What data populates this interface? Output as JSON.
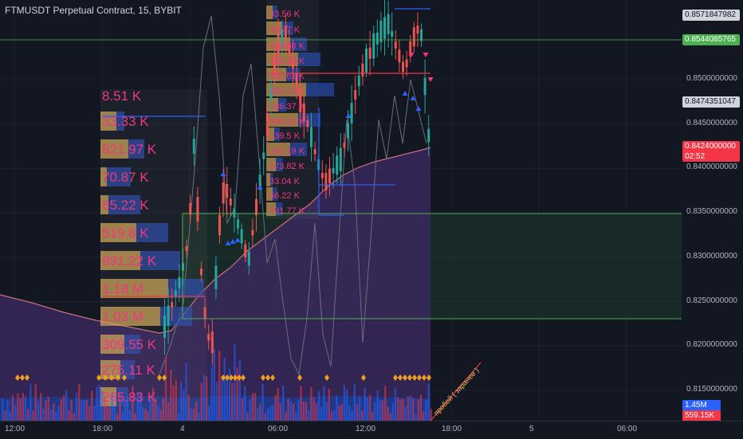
{
  "header": {
    "symbol": "FTMUSDT Perpetual Contract",
    "interval": "15",
    "exchange": "BYBIT"
  },
  "price_labels": [
    "0.8500000000",
    "0.8450000000",
    "0.8400000000",
    "0.8350000000",
    "0.8300000000",
    "0.8250000000",
    "0.8200000000",
    "0.8150000000"
  ],
  "badges": {
    "b1": "0.8571847982",
    "b2": "0.8544085765",
    "b3": "0.8474351047",
    "last_price": "0.8424000000",
    "countdown": "02:52",
    "vol1": "1.45M",
    "vol2": "559.15K"
  },
  "time_labels": [
    "12:00",
    "18:00",
    "4",
    "06:00",
    "12:00",
    "18:00",
    "5",
    "06:00"
  ],
  "volume_profile_labels": [
    "8.51 K",
    "33.33 K",
    "821.97 K",
    "70.87 K",
    "65.22 K",
    "519.8 K",
    "991.22 K",
    "1.18 M",
    "1.03 M",
    "309.55 K",
    "275.11 K",
    "265.83 K"
  ],
  "profile2_labels": [
    "33.56 K",
    "355.7 K",
    "514.68 K",
    "368.33 K",
    "251.61 K",
    "402.2 K",
    "186.37 K",
    "358.54 K",
    "139.5 K",
    "343.19 K",
    "173.82 K",
    "33.04 K",
    "56.22 K",
    "191.77 K"
  ],
  "annotation": "пробой ( заранее )",
  "colors": {
    "up": "#26a69a",
    "down": "#ef5350",
    "accent_red": "#f23645",
    "accent_green": "#4caf50",
    "blue": "#2962ff"
  },
  "chart_data": {
    "type": "candlestick",
    "title": "FTMUSDT Perpetual Contract, 15, BYBIT",
    "ylim": [
      0.8125,
      0.8575
    ],
    "x_ticks": [
      "12:00",
      "18:00",
      "4",
      "06:00",
      "12:00",
      "18:00",
      "5",
      "06:00"
    ],
    "horizontal_levels": [
      0.8544085765,
      0.835,
      0.823
    ],
    "last_price": 0.8424,
    "grid": true,
    "legend": "none"
  }
}
